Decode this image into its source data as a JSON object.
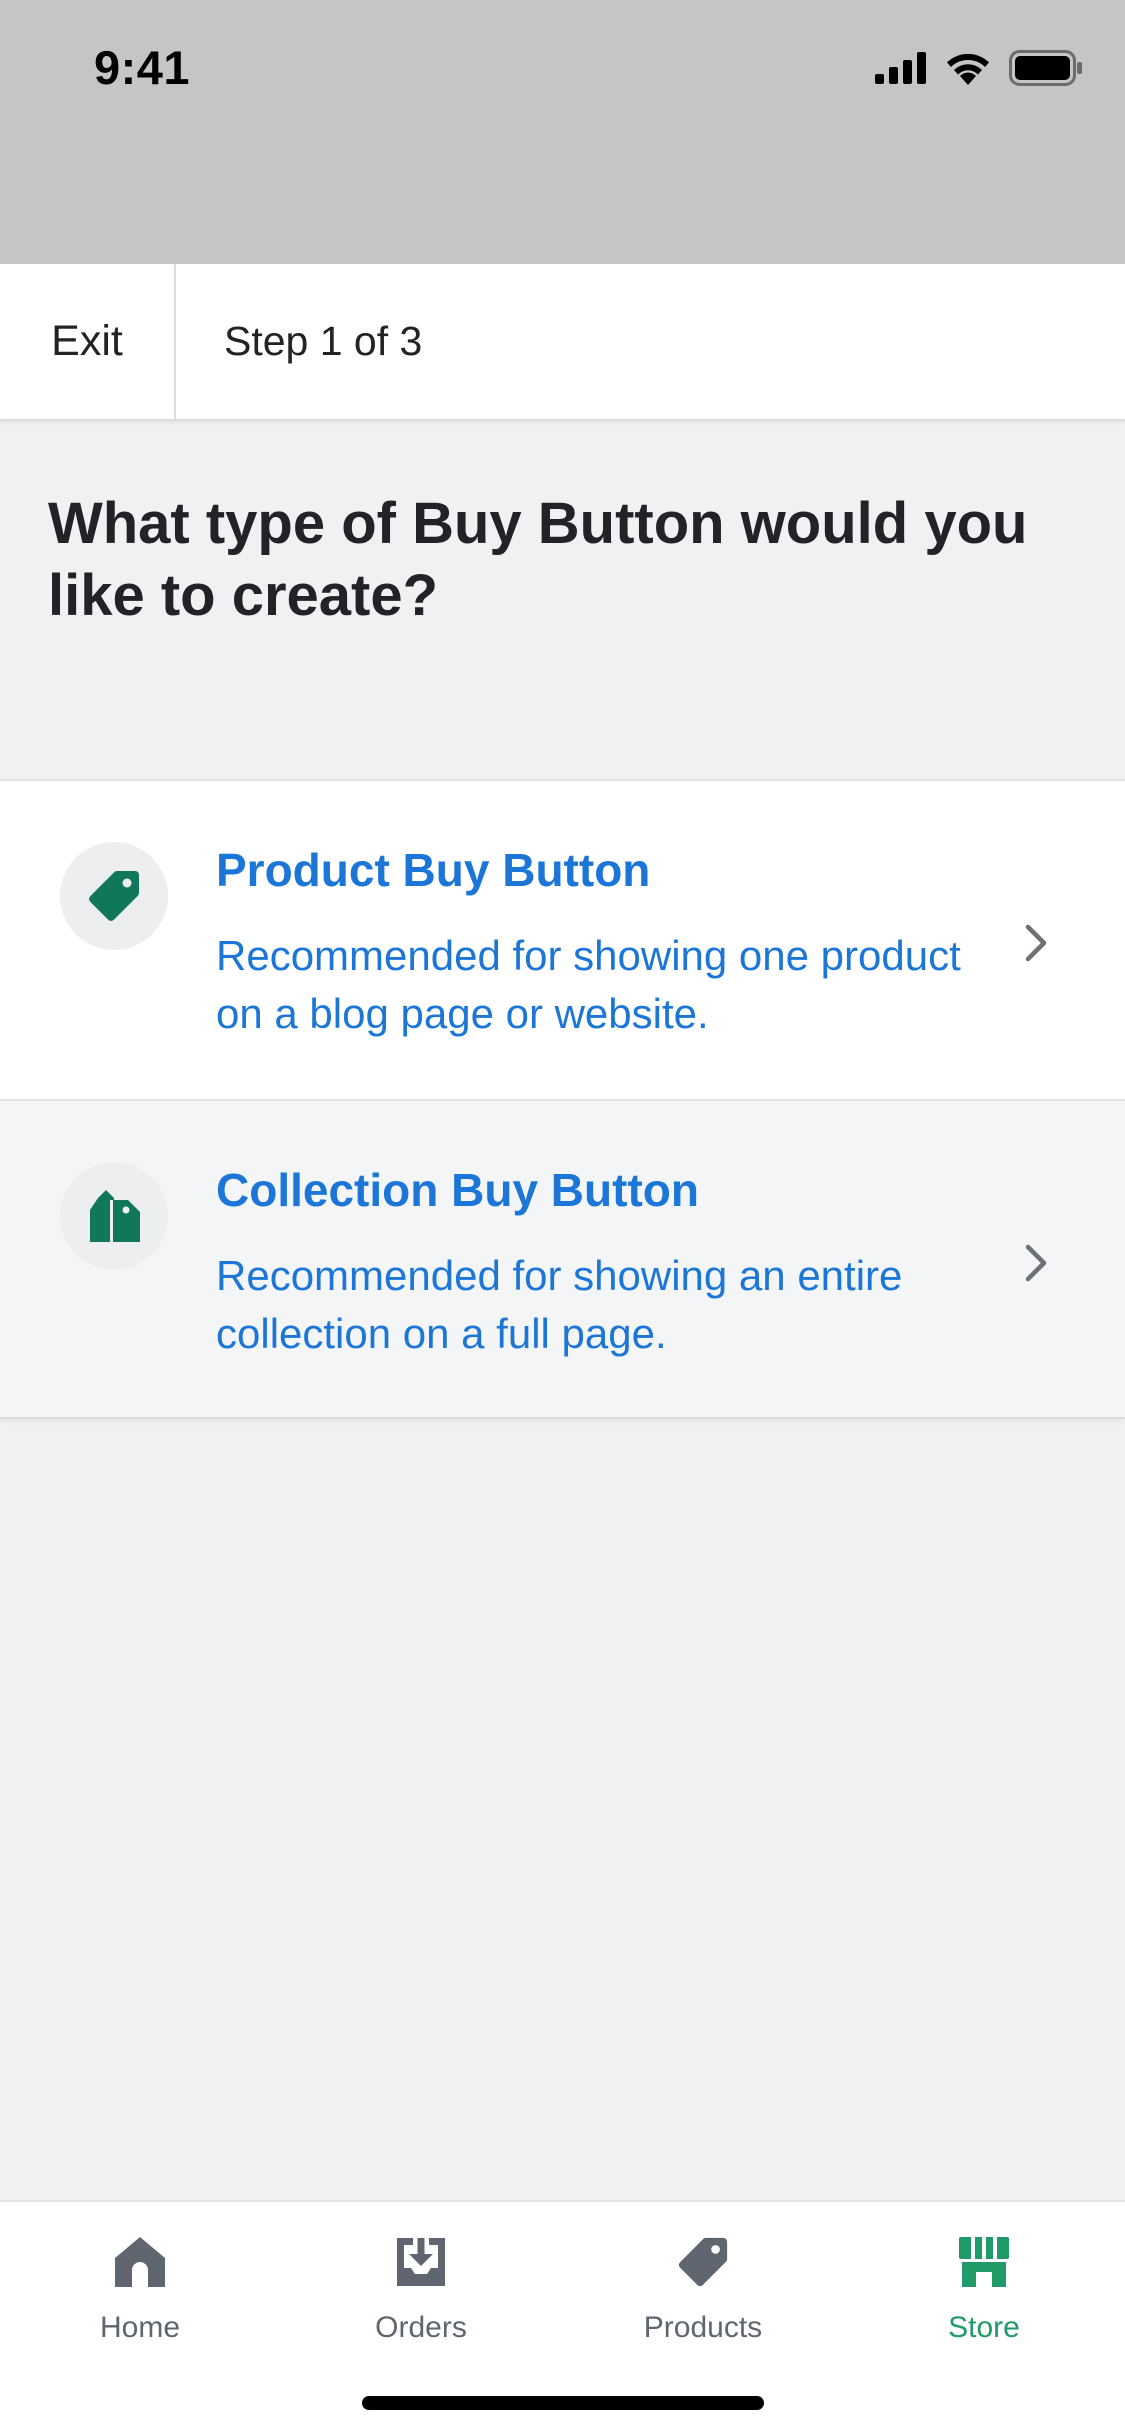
{
  "status_bar": {
    "time": "9:41",
    "icons": [
      "signal-icon",
      "wifi-icon",
      "battery-icon"
    ]
  },
  "top_nav": {
    "exit_label": "Exit",
    "step_label": "Step 1 of 3"
  },
  "page": {
    "title": "What type of Buy Button would you like to create?"
  },
  "options": [
    {
      "icon": "price-tag-icon",
      "title": "Product Buy Button",
      "description": "Recommended for showing one product on a blog page or website."
    },
    {
      "icon": "tag-group-icon",
      "title": "Collection Buy Button",
      "description": "Recommended for showing an entire collection on a full page."
    }
  ],
  "tab_bar": {
    "tabs": [
      {
        "label": "Home",
        "icon": "home-icon"
      },
      {
        "label": "Orders",
        "icon": "orders-icon"
      },
      {
        "label": "Products",
        "icon": "products-tag-icon"
      },
      {
        "label": "Store",
        "icon": "store-icon"
      }
    ],
    "active": "Store"
  },
  "colors": {
    "link_blue": "#1c76d8",
    "icon_green": "#11775a",
    "active_green": "#1f9a68",
    "inactive_grey": "#5f6670"
  }
}
